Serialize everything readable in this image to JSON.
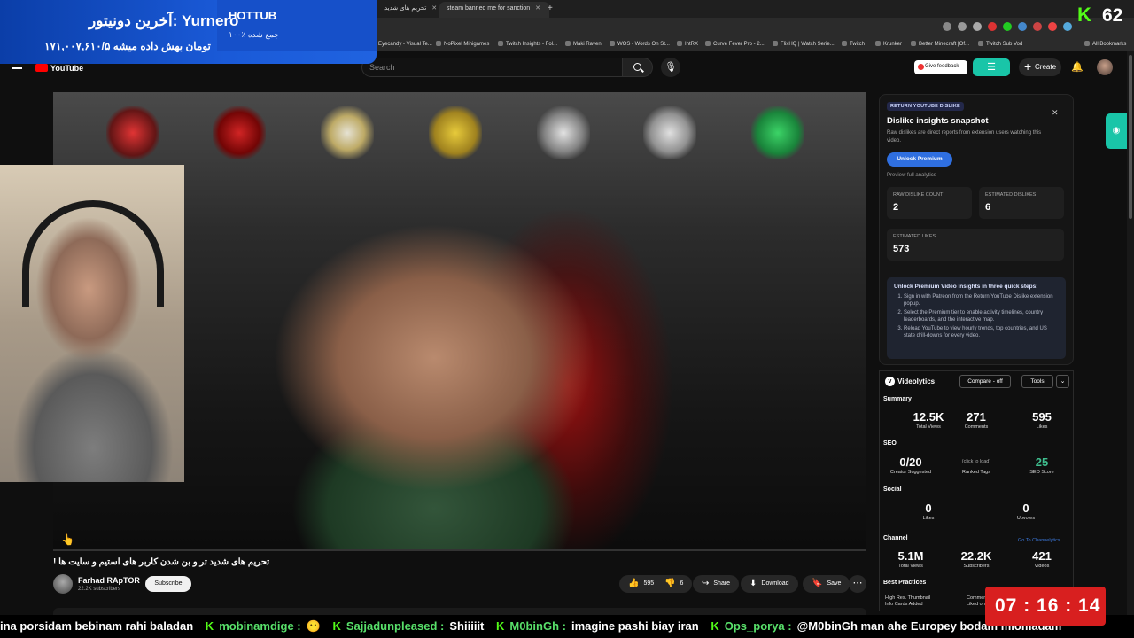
{
  "browser": {
    "tabs": [
      {
        "label": "تحریم های شدید"
      },
      {
        "label": "steam banned me for sanction"
      }
    ],
    "bookmarks": [
      "Eyecandy - Visual Te...",
      "NoPixel Minigames",
      "Twitch Insights - Fol...",
      "Maki Raven",
      "WOS - Words On St...",
      "IntRX",
      "Curve Fever Pro - 2...",
      "FlixHQ | Watch Serie...",
      "Twitch",
      "Krunker",
      "Better Minecraft [Of...",
      "Twitch Sub Vod",
      "All Bookmarks"
    ]
  },
  "donation": {
    "title": "آخرین دونیتور: Yurnero",
    "amount": "۱۷۱,۰۰۷,۶۱۰/۵ تومان بهش داده میشه",
    "hottub": "HOTTUB",
    "hottub_sub": "۱۰۰٪ جمع شده"
  },
  "kick": {
    "icon": "K",
    "viewers": "62"
  },
  "youtube": {
    "logo": "YouTube",
    "search_placeholder": "Search",
    "give_feedback": "Give feedback",
    "create": "Create",
    "video_title": "تحریم های شدید تر و بن شدن کاربر های استیم و سایت ها !",
    "channel": {
      "name": "Farhad RApTOR",
      "subs": "22.2K subscribers"
    },
    "subscribe": "Subscribe",
    "like_count": "595",
    "dislike_count": "6",
    "share": "Share",
    "download": "Download",
    "save": "Save"
  },
  "ryd": {
    "badge": "RETURN YOUTUBE DISLIKE",
    "title": "Dislike insights snapshot",
    "desc": "Raw dislikes are direct reports from extension users watching this video.",
    "unlock": "Unlock Premium",
    "preview": "Preview full analytics",
    "raw_label": "RAW DISLIKE COUNT",
    "raw_value": "2",
    "est_dis_label": "ESTIMATED DISLIKES",
    "est_dis_value": "6",
    "est_likes_label": "ESTIMATED LIKES",
    "est_likes_value": "573",
    "steps_title": "Unlock Premium Video Insights in three quick steps:",
    "steps": [
      "Sign in with Patreon from the Return YouTube Dislike extension popup.",
      "Select the Premium tier to enable activity timelines, country leaderboards, and the interactive map.",
      "Reload YouTube to view hourly trends, top countries, and US state drill-downs for every video."
    ]
  },
  "videolytics": {
    "name": "Videolytics",
    "compare": "Compare - off",
    "tools": "Tools",
    "summary": "Summary",
    "views": "12.5K",
    "views_l": "Total Views",
    "comments": "271",
    "comments_l": "Comments",
    "likes": "595",
    "likes_l": "Likes",
    "seo": "SEO",
    "creator_sug": "0/20",
    "creator_sug_l": "Creator Suggested",
    "ranked_note": "(click to load)",
    "ranked_l": "Ranked Tags",
    "seo_score": "25",
    "seo_score_l": "SEO Score",
    "social": "Social",
    "s_likes": "0",
    "s_likes_l": "Likes",
    "s_upvotes": "0",
    "s_upvotes_l": "Upvotes",
    "channel": "Channel",
    "go_to": "Go To Channelytics",
    "c_views": "5.1M",
    "c_views_l": "Total Views",
    "c_subs": "22.2K",
    "c_subs_l": "Subscribers",
    "c_videos": "421",
    "c_videos_l": "Videos",
    "best": "Best Practices",
    "bp1": "High Res. Thumbnail",
    "bp2": "Info Cards Added",
    "bp3": "Comment",
    "bp4": "Liked on F"
  },
  "ticker": {
    "lead": "ina porsidam bebinam rahi baladan",
    "messages": [
      {
        "user": "mobinamdige :",
        "text": "😶"
      },
      {
        "user": "Sajjadunpleased :",
        "text": "Shiiiiit"
      },
      {
        "user": "M0binGh :",
        "text": "imagine pashi biay iran"
      },
      {
        "user": "Ops_porya :",
        "text": "@M0binGh man ahe Europey bodam miomadam"
      }
    ]
  },
  "timer": "07 : 16 : 14"
}
